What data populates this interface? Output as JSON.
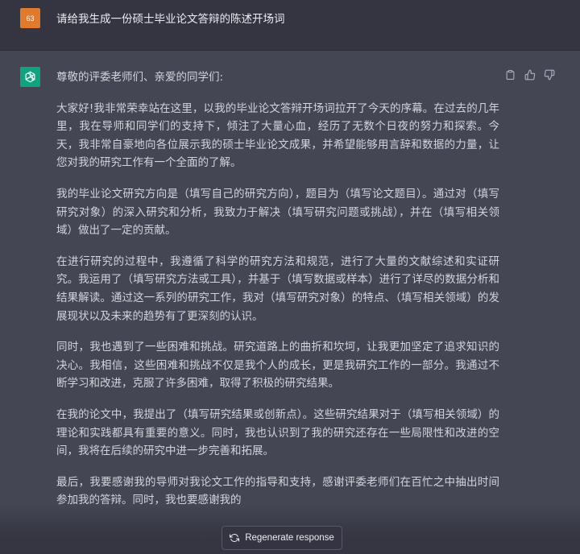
{
  "user_message": {
    "avatar_label": "63",
    "text": "请给我生成一份硕士毕业论文答辩的陈述开场词"
  },
  "assistant_message": {
    "greeting": "尊敬的评委老师们、亲爱的同学们:",
    "paragraphs": [
      "大家好!我非常荣幸站在这里，以我的毕业论文答辩开场词拉开了今天的序幕。在过去的几年里，我在导师和同学们的支持下，倾注了大量心血，经历了无数个日夜的努力和探索。今天，我非常自豪地向各位展示我的硕士毕业论文成果，并希望能够用言辞和数据的力量，让您对我的研究工作有一个全面的了解。",
      "我的毕业论文研究方向是（填写自己的研究方向），题目为（填写论文题目）。通过对（填写研究对象）的深入研究和分析，我致力于解决（填写研究问题或挑战），并在（填写相关领域）做出了一定的贡献。",
      "在进行研究的过程中，我遵循了科学的研究方法和规范，进行了大量的文献综述和实证研究。我运用了（填写研究方法或工具），并基于（填写数据或样本）进行了详尽的数据分析和结果解读。通过这一系列的研究工作，我对（填写研究对象）的特点、（填写相关领域）的发展现状以及未来的趋势有了更深刻的认识。",
      "同时，我也遇到了一些困难和挑战。研究道路上的曲折和坎坷，让我更加坚定了追求知识的决心。我相信，这些困难和挑战不仅是我个人的成长，更是我研究工作的一部分。我通过不断学习和改进，克服了许多困难，取得了积极的研究结果。",
      "在我的论文中，我提出了（填写研究结果或创新点）。这些研究结果对于（填写相关领域）的理论和实践都具有重要的意义。同时，我也认识到了我的研究还存在一些局限性和改进的空间，我将在后续的研究中进一步完善和拓展。",
      "最后，我要感谢我的导师对我论文工作的指导和支持，感谢评委老师们在百忙之中抽出时间参加我的答辩。同时，我也要感谢我的"
    ]
  },
  "actions": {
    "copy_icon": "clipboard-icon",
    "like_icon": "thumbs-up-icon",
    "dislike_icon": "thumbs-down-icon"
  },
  "regenerate_button": {
    "label": "Regenerate response",
    "icon": "refresh-icon"
  },
  "colors": {
    "user_bg": "#343541",
    "assistant_bg": "#444654",
    "user_avatar": "#e07a2c",
    "bot_avatar": "#10a37f",
    "text": "#d1d5db"
  }
}
